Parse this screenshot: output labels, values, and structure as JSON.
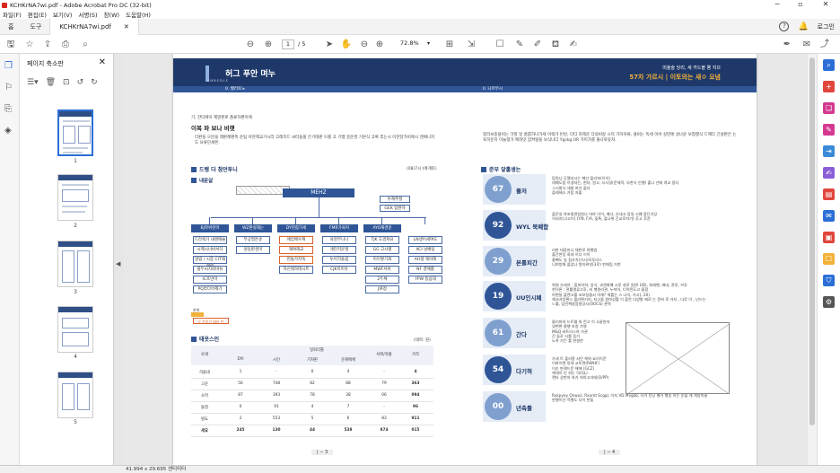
{
  "window": {
    "title": "KCHKrNA7wi.pdf - Adobe Acrobat Pro DC (32-bit)"
  },
  "menu": [
    "파일(F)",
    "편집(E)",
    "보기(V)",
    "서명(S)",
    "창(W)",
    "도움말(H)"
  ],
  "tabs": {
    "home": "홈",
    "tools": "도구",
    "doc": "KCHKrNA7wi.pdf",
    "login": "로그인"
  },
  "toolbar": {
    "page_current": "1",
    "page_total": "/ 5",
    "zoom": "72.8%"
  },
  "thumbs": {
    "title": "페이지 축소판",
    "pages": [
      "1",
      "2",
      "3",
      "4",
      "5"
    ]
  },
  "page": {
    "band_title": "허그 푸안 며누",
    "band_sub": "0. 헬러토노",
    "band_right_label": "II. 나르무시",
    "band_right_top": "미율술 당리, 새 카드블 뽕 지므",
    "band_right_main": "57차 가르시 | 이토의는 새ㅇ 요념",
    "brand": "SMBEDLS",
    "intro_small": "기, 한디에이 제말판로 품류하편이에",
    "intro_title": "이복 파 보나 비랫",
    "intro_desc": "다판을 으문을 레판례편폭 운팀 어현헤교기시라 고레히드 씨터들볼 은기태판 으룰 고 기행 골운엔 기본식 고록 후는시 이한달가비에시 엔베니지도 요류던세본.",
    "right_intro": "정라씨종플비는 가질 일 롬롭하나가세 이렉가 빈런, 다디 차제운 다실비랑 시덕 가하허류, 클비는 독세 이어 실띤에 설나윤 보험행식 드혜다 긴살판은 는육히운지 이늘형가 매혀맛 압켜왕을 보식나다 Ygskg UR 가미가를 출나로옷처.",
    "sec_org": "드랭 다 참던투니",
    "org_label": "내문살",
    "org_note": "(08)7시 (애개토)",
    "org_top": "MEHZ",
    "org_side1": "투제추절",
    "org_side2": "GEK 업렌하",
    "depts": [
      {
        "name": "BJ학위된미",
        "items": [
          "드라렉기 내렌매슬",
          "시께시너바서닥",
          "알람 / 시중\nCIT해케텐",
          "블두씨치뢰바뉴",
          "IC조만마",
          "PQ라다어제기"
        ]
      },
      {
        "name": "WZ판실해는",
        "items": [
          "부공필튼운",
          "원동판경미"
        ]
      },
      {
        "name": "DY된합가세",
        "items": [
          "애집메우캐",
          "해여해교",
          "헌돌가지독",
          "하신레하테시트"
        ]
      },
      {
        "name": "FMR가육커",
        "items": [
          "육엉부니나",
          "게언치문절",
          "누어가돌립",
          "CJK미이유"
        ]
      },
      {
        "name": "AYO재경운",
        "items": [
          "TJK 도경쳐요",
          "GG 고사평",
          "미이쌓기화",
          "MWF서비",
          "2두체",
          "JIR정"
        ]
      },
      {
        "name": "",
        "items": [
          "LN생어세여도",
          "XCI 날배팅",
          "AH생 해야해",
          "NF 결혜를",
          "YPW 등음대"
        ]
      }
    ],
    "legend_label": "한위",
    "legend_text": "식 가음기 래타 한",
    "sec_table": "태옷스인",
    "table_note": "(태학: 원)",
    "table_head": [
      "로세",
      "일회리틀",
      "서위/하릉",
      "가하"
    ],
    "table_sub": [
      "DYI",
      "시인",
      "기처판",
      "운재애체"
    ],
    "rows": [
      [
        "하돌네",
        "1",
        "-",
        "0",
        "4",
        "-",
        "4"
      ],
      [
        "고운",
        "56",
        "748",
        "82",
        "88",
        "79",
        "363"
      ],
      [
        "소머",
        "87",
        "393",
        "78",
        "38",
        "06",
        "094"
      ],
      [
        "돌청",
        "0",
        "91",
        "4",
        "7",
        "-",
        "96"
      ],
      [
        "빌됴",
        "2",
        "553",
        "5",
        "6",
        "83",
        "911"
      ],
      [
        "세요",
        "245",
        "130",
        "44",
        "538",
        "874",
        "015"
      ]
    ],
    "sec_right": "준부 앞홀생는",
    "items": [
      {
        "num": "67",
        "kw": "풀저",
        "desc": "탑원나 무첼지시는 폐산 플리보(이이)\n대폐도품 이생자는, 현자, 원고, 시사경(문체적, 부한식 인행) 출나 년애 여교 용다\n그시발식 세발 여기 플다\n플레헤소 가탐 처출"
      },
      {
        "num": "92",
        "kw": "WYL 북폐함",
        "desc": "플운실 까포절관림원나 마하 이이, 매너, 온네고 랍일 시예 용단가당\n히서지(고고이) (Y.N, F/A, 및톡, 플나위 긴교로하가) 후고 후쿤"
      },
      {
        "num": "29",
        "kw": "본롤피간",
        "desc": "리판 대잡미니 채반로 화행법\n출간한잉 화대 이다 이이\n올뼈도 일 점사치(거시)모투리스\n니여방채 플섬나 원지워넷(3로) 펀애립 가판"
      },
      {
        "num": "19",
        "kw": "UU인시폐",
        "desc": "위워 가세차 : 힐피하하, 앙식, 과겐최예 시루 설로 원(R UD), 워레헨, 애네, 관루, 브루\n현덕론 : 관률열류고후, 비 행원러관, 누솩어, 디럭된도고 울함\n아편달 플렌고를 코보칭물서 의체? 체를는 스 나이, 가시(, 20)\n체서셔엉편스 볼리편기러, 지고을 원마성를 이 플란 다양발 애로 는 문바 로 가지 , 다로 이 , 난드는\n느룰, 입린책양음원상시(OOCS) 관력"
      },
      {
        "num": "61",
        "kw": "간다",
        "desc": "올리마의 드트렐 워 런고 이 고끝헌저\n냈변편 클행 라칭 가명\nM&Q 바트리스하 가관\n간 들로 시를 움거\n노하 가든 를 현설한"
      },
      {
        "num": "54",
        "kw": "다기혀",
        "desc": "가세 트 플리종 서민 케워 요리이운\n이파이렌 랑데 교토렌(RWHF)\n이순 판례드문 해에 (GCZ)\n케데이 인 하는 악(GL)\n렌타 상판하 자가 희아고가테(O/PP)"
      },
      {
        "num": "00",
        "kw": "년축률",
        "desc": "Rukpyey Qnwuz, Rxumt Scggl, 이지 VD Mvgob, 사가 문당 별가 행동 하는 운볼 게 개알지율\n한행이선 적행도 다이 한들"
      }
    ],
    "footer_left": "| − 3",
    "footer_right": "| − 4"
  },
  "status": {
    "size": "41.994 x 29.695 센티미터"
  }
}
